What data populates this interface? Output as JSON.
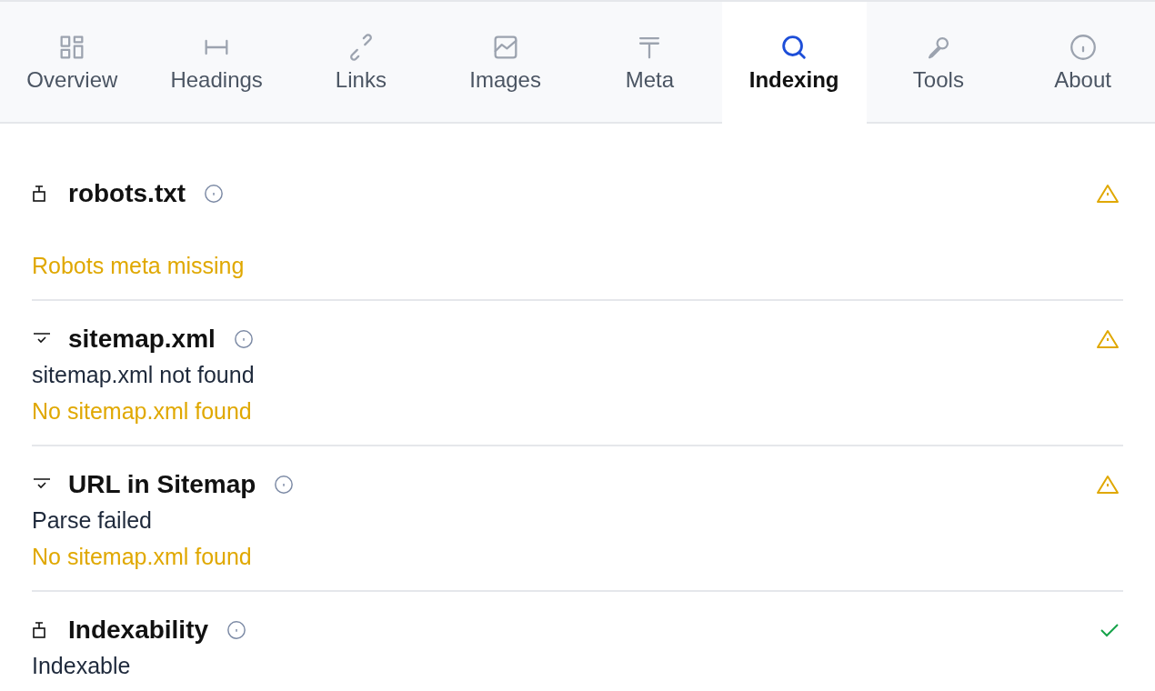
{
  "tabs": [
    {
      "label": "Overview",
      "selected": false
    },
    {
      "label": "Headings",
      "selected": false
    },
    {
      "label": "Links",
      "selected": false
    },
    {
      "label": "Images",
      "selected": false
    },
    {
      "label": "Meta",
      "selected": false
    },
    {
      "label": "Indexing",
      "selected": true
    },
    {
      "label": "Tools",
      "selected": false
    },
    {
      "label": "About",
      "selected": false
    }
  ],
  "sections": [
    {
      "title": "robots.txt",
      "kind": "warning",
      "warning": "Robots meta missing"
    },
    {
      "title": "sitemap.xml",
      "kind": "warning",
      "detail": "sitemap.xml not found",
      "warning": "No sitemap.xml found"
    },
    {
      "title": "URL in Sitemap",
      "kind": "warning",
      "detail": "Parse failed",
      "warning": "No sitemap.xml found"
    },
    {
      "title": "Indexability",
      "kind": "ok",
      "detail": "Indexable"
    }
  ]
}
